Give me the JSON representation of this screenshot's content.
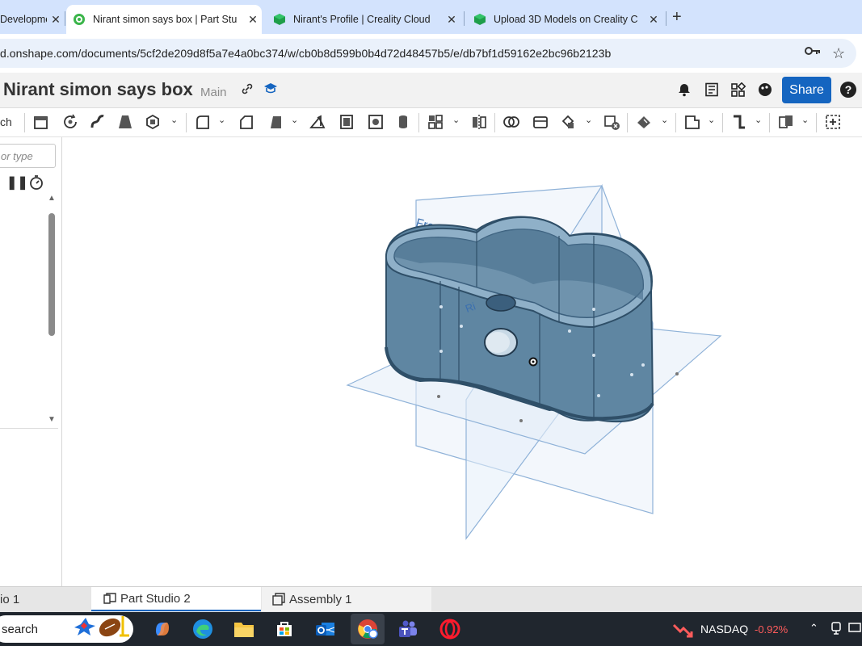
{
  "browser": {
    "tabs": [
      {
        "title": "Developmen",
        "active": false
      },
      {
        "title": "Nirant simon says box | Part Stu",
        "active": true
      },
      {
        "title": "Nirant's Profile | Creality Cloud",
        "active": false
      },
      {
        "title": "Upload 3D Models on Creality C",
        "active": false
      }
    ],
    "url": "d.onshape.com/documents/5cf2de209d8f5a7e4a0bc374/w/cb0b8d599b0b4d72d48457b5/e/db7bf1d59162e2bc96b2123b"
  },
  "header": {
    "doc_title": "Nirant simon says box",
    "branch": "Main",
    "share_label": "Share",
    "help_label": "?"
  },
  "toolbar": {
    "sketch_label": "ch"
  },
  "feature_panel": {
    "filter_placeholder": "or type"
  },
  "viewport": {
    "plane_labels": {
      "front": "Front",
      "right": "Ri"
    },
    "colors": {
      "body": "#5f86a2",
      "plane": "#7ea6d3",
      "rim": "#3b5f7d"
    }
  },
  "bottom_tabs": [
    {
      "label": "io 1",
      "active": false
    },
    {
      "label": "Part Studio 2",
      "active": true
    },
    {
      "label": "Assembly 1",
      "active": false
    }
  ],
  "taskbar": {
    "search_label": "search",
    "ticker": "NASDAQ",
    "ticker_change": "-0.92%"
  }
}
